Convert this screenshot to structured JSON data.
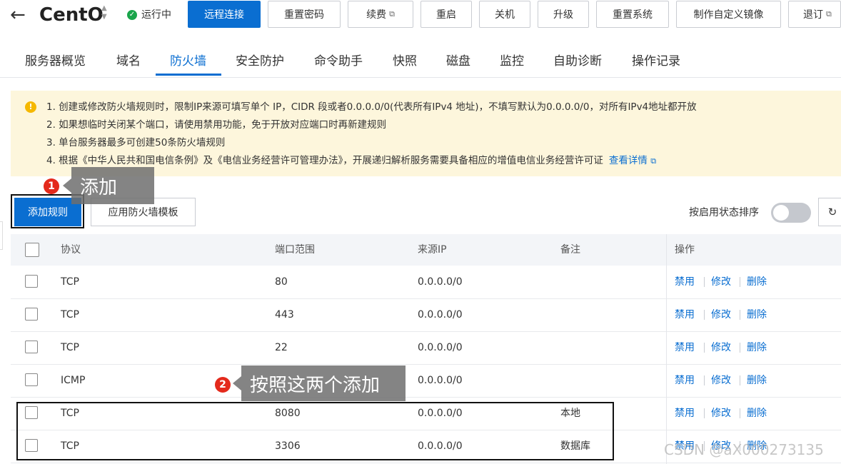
{
  "header": {
    "back_icon": "←",
    "instance_name": "CentO",
    "sort_icon": "▲▼",
    "status_icon": "✓",
    "status_text": "运行中",
    "buttons": [
      {
        "label": "远程连接",
        "primary": true
      },
      {
        "label": "重置密码"
      },
      {
        "label": "续费",
        "external": true
      },
      {
        "label": "重启"
      },
      {
        "label": "关机"
      },
      {
        "label": "升级"
      },
      {
        "label": "重置系统"
      },
      {
        "label": "制作自定义镜像"
      },
      {
        "label": "退订",
        "external": true
      }
    ],
    "external_icon": "⧉"
  },
  "tabs": [
    "服务器概览",
    "域名",
    "防火墙",
    "安全防护",
    "命令助手",
    "快照",
    "磁盘",
    "监控",
    "自助诊断",
    "操作记录"
  ],
  "active_tab": "防火墙",
  "notice": {
    "icon": "!",
    "lines": [
      "1. 创建或修改防火墙规则时，限制IP来源可填写单个 IP，CIDR 段或者0.0.0.0/0(代表所有IPv4 地址)，不填写默认为0.0.0.0/0，对所有IPv4地址都开放",
      "2. 如果想临时关闭某个端口，请使用禁用功能，免于开放对应端口时再新建规则",
      "3. 单台服务器最多可创建50条防火墙规则",
      "4. 根据《中华人民共和国电信条例》及《电信业务经营许可管理办法》，开展递归解析服务需要具备相应的增值电信业务经营许可证"
    ],
    "link": "查看详情"
  },
  "toolbar": {
    "add_rule": "添加规则",
    "apply_template": "应用防火墙模板",
    "sort_label": "按启用状态排序",
    "refresh_icon": "↻",
    "toggle_on": false
  },
  "table": {
    "headers": {
      "protocol": "协议",
      "port": "端口范围",
      "source_ip": "来源IP",
      "remark": "备注",
      "ops": "操作"
    },
    "rows": [
      {
        "protocol": "TCP",
        "port": "80",
        "source_ip": "0.0.0.0/0",
        "remark": ""
      },
      {
        "protocol": "TCP",
        "port": "443",
        "source_ip": "0.0.0.0/0",
        "remark": ""
      },
      {
        "protocol": "TCP",
        "port": "22",
        "source_ip": "0.0.0.0/0",
        "remark": ""
      },
      {
        "protocol": "ICMP",
        "port": "",
        "source_ip": "0.0.0.0/0",
        "remark": ""
      },
      {
        "protocol": "TCP",
        "port": "8080",
        "source_ip": "0.0.0.0/0",
        "remark": "本地"
      },
      {
        "protocol": "TCP",
        "port": "3306",
        "source_ip": "0.0.0.0/0",
        "remark": "数据库"
      }
    ],
    "ops": {
      "disable": "禁用",
      "edit": "修改",
      "delete": "删除"
    }
  },
  "annotations": {
    "badge_1": "1",
    "callout_1": "添加",
    "badge_2": "2",
    "callout_2": "按照这两个添加"
  },
  "watermark": "CSDN @aX000273135",
  "colors": {
    "primary": "#0a6ed1",
    "notice_bg": "#fdf6dc",
    "badge_red": "#e42a1c",
    "status_green": "#1aa54b"
  }
}
